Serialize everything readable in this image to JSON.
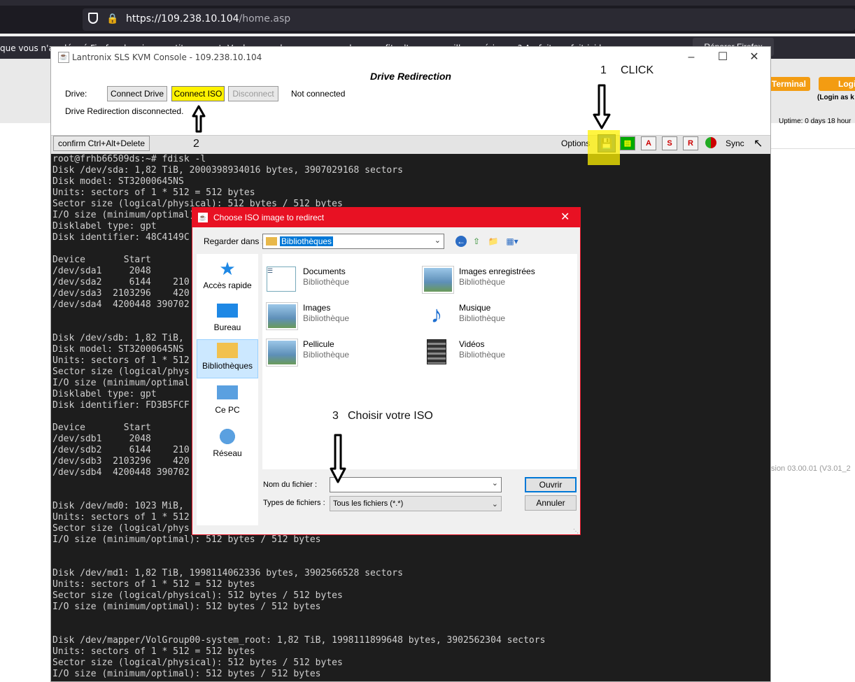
{
  "browser": {
    "url_host": "https://109.238.10.104",
    "url_path": "/home.asp",
    "notification_text": "que vous n'ay          dé... é Firefox depuis un petit moment. Voulez-vous le... ...  pour ne plus... ...ofits d'une... ... ...ille expérience ? Au fait, on fait ici le... ...",
    "notification_button": "Réparer Firefox"
  },
  "webpage": {
    "terminal_button": "Terminal",
    "login_button": "Login",
    "login_as": "(Login as k",
    "uptime": "Uptime: 0 days 18 hour",
    "version": "sion 03.00.01 (V3.01_2"
  },
  "kvm": {
    "title": "Lantronix SLS KVM Console - 109.238.10.104",
    "panel_title": "Drive Redirection",
    "drive_label": "Drive:",
    "connect_drive": "Connect Drive",
    "connect_iso": "Connect ISO",
    "disconnect": "Disconnect",
    "connection_status": "Not connected",
    "redirection_status": "Drive Redirection disconnected.",
    "cad_button": "confirm Ctrl+Alt+Delete",
    "options_label": "Options",
    "toolbar_icons": [
      "A",
      "S",
      "R"
    ],
    "sync_label": "Sync"
  },
  "terminal_lines": [
    "root@frhb66509ds:~# fdisk -l",
    "Disk /dev/sda: 1,82 TiB, 2000398934016 bytes, 3907029168 sectors",
    "Disk model: ST32000645NS",
    "Units: sectors of 1 * 512 = 512 bytes",
    "Sector size (logical/physical): 512 bytes / 512 bytes",
    "I/O size (minimum/optimal): 512 bytes / 512 bytes",
    "Disklabel type: gpt",
    "Disk identifier: 48C4149C",
    "",
    "Device       Start",
    "/dev/sda1     2048",
    "/dev/sda2     6144    210",
    "/dev/sda3  2103296    420",
    "/dev/sda4  4200448 390702",
    "",
    "",
    "Disk /dev/sdb: 1,82 TiB,",
    "Disk model: ST32000645NS",
    "Units: sectors of 1 * 512",
    "Sector size (logical/phys",
    "I/O size (minimum/optimal",
    "Disklabel type: gpt",
    "Disk identifier: FD3B5FCF",
    "",
    "Device       Start",
    "/dev/sdb1     2048",
    "/dev/sdb2     6144    210",
    "/dev/sdb3  2103296    420",
    "/dev/sdb4  4200448 390702",
    "",
    "",
    "Disk /dev/md0: 1023 MiB,",
    "Units: sectors of 1 * 512",
    "Sector size (logical/phys",
    "I/O size (minimum/optimal): 512 bytes / 512 bytes",
    "",
    "",
    "Disk /dev/md1: 1,82 TiB, 1998114062336 bytes, 3902566528 sectors",
    "Units: sectors of 1 * 512 = 512 bytes",
    "Sector size (logical/physical): 512 bytes / 512 bytes",
    "I/O size (minimum/optimal): 512 bytes / 512 bytes",
    "",
    "",
    "Disk /dev/mapper/VolGroup00-system_root: 1,82 TiB, 1998111899648 bytes, 3902562304 sectors",
    "Units: sectors of 1 * 512 = 512 bytes",
    "Sector size (logical/physical): 512 bytes / 512 bytes",
    "I/O size (minimum/optimal): 512 bytes / 512 bytes"
  ],
  "annotations": {
    "step1_num": "1",
    "step1_text": "CLICK",
    "step2_num": "2",
    "step3_num": "3",
    "step3_text": "Choisir votre ISO"
  },
  "dialog": {
    "title": "Choose ISO image to redirect",
    "lookin_label": "Regarder dans :",
    "lookin_value": "Bibliothèques",
    "places": [
      "Accès rapide",
      "Bureau",
      "Bibliothèques",
      "Ce PC",
      "Réseau"
    ],
    "items": [
      {
        "name": "Documents",
        "sub": "Bibliothèque"
      },
      {
        "name": "Images enregistrées",
        "sub": "Bibliothèque"
      },
      {
        "name": "Images",
        "sub": "Bibliothèque"
      },
      {
        "name": "Musique",
        "sub": "Bibliothèque"
      },
      {
        "name": "Pellicule",
        "sub": "Bibliothèque"
      },
      {
        "name": "Vidéos",
        "sub": "Bibliothèque"
      }
    ],
    "filename_label": "Nom du fichier :",
    "filename_value": "",
    "filetype_label": "Types de fichiers :",
    "filetype_value": "Tous les fichiers (*.*)",
    "open_button": "Ouvrir",
    "cancel_button": "Annuler"
  },
  "colors": {
    "highlight": "#fff200",
    "dialog_titlebar": "#e81123",
    "orange_button": "#f39c12"
  }
}
